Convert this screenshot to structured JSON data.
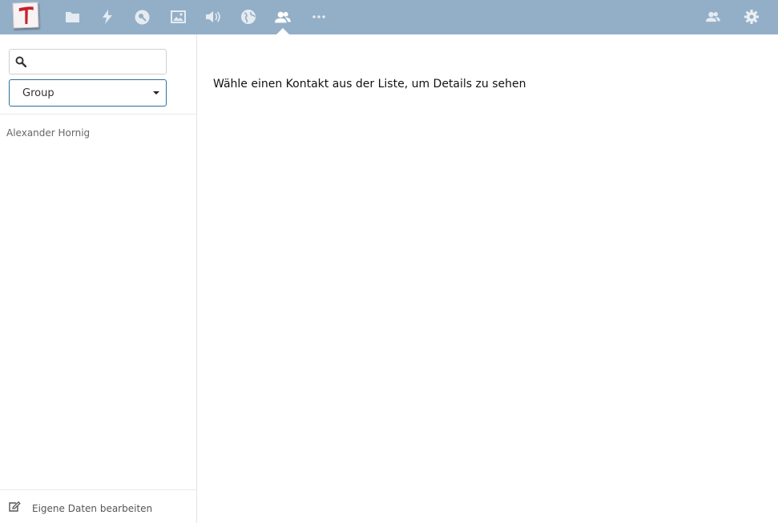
{
  "colors": {
    "header_bg": "#93afc7",
    "icon_color": "#ffffff",
    "select_border": "#2e6f9c",
    "logo_cross": "#c8202d"
  },
  "header": {
    "nav_icons": [
      "files-icon",
      "activity-icon",
      "passwords-icon",
      "gallery-icon",
      "music-icon",
      "globe-icon",
      "contacts-icon",
      "more-icon"
    ],
    "active_app": "contacts-icon",
    "right_icons": [
      "contacts-menu-icon",
      "settings-icon"
    ]
  },
  "sidebar": {
    "search": {
      "placeholder": "",
      "value": ""
    },
    "group_select": {
      "selected": "Group"
    },
    "contacts": [
      {
        "name": "Alexander Hornig"
      }
    ],
    "footer": {
      "label": "Eigene Daten bearbeiten"
    }
  },
  "main": {
    "empty_message": "Wähle einen Kontakt aus der Liste, um Details zu sehen"
  }
}
